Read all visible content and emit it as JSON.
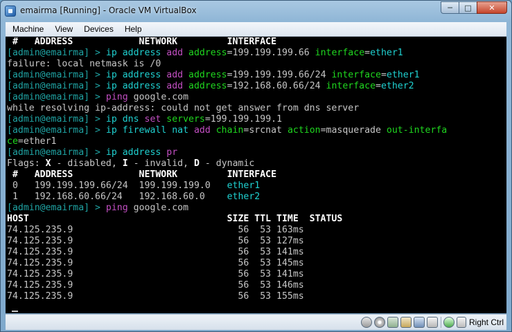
{
  "window": {
    "title": "emairma [Running] - Oracle VM VirtualBox",
    "controls": {
      "minimize": "─",
      "maximize": "□",
      "close": "✕"
    }
  },
  "menu": {
    "items": [
      "Machine",
      "View",
      "Devices",
      "Help"
    ]
  },
  "console": {
    "lines": [
      [
        {
          "t": " #   ADDRESS            NETWORK         INTERFACE",
          "c": "bold"
        }
      ],
      [
        {
          "t": "[admin@emairma] > ",
          "c": "prompt"
        },
        {
          "t": "ip address",
          "c": "path"
        },
        {
          "t": " add",
          "c": "verb"
        },
        {
          "t": " address",
          "c": "key"
        },
        {
          "t": "=199.199.199.66 ",
          "c": "val"
        },
        {
          "t": "interface",
          "c": "key"
        },
        {
          "t": "=",
          "c": "val"
        },
        {
          "t": "ether1",
          "c": "iface"
        }
      ],
      [
        {
          "t": "failure: local netmask is /0",
          "c": "val"
        }
      ],
      [
        {
          "t": "[admin@emairma] > ",
          "c": "prompt"
        },
        {
          "t": "ip address",
          "c": "path"
        },
        {
          "t": " add",
          "c": "verb"
        },
        {
          "t": " address",
          "c": "key"
        },
        {
          "t": "=199.199.199.66/24 ",
          "c": "val"
        },
        {
          "t": "interface",
          "c": "key"
        },
        {
          "t": "=",
          "c": "val"
        },
        {
          "t": "ether1",
          "c": "iface"
        }
      ],
      [
        {
          "t": "[admin@emairma] > ",
          "c": "prompt"
        },
        {
          "t": "ip address",
          "c": "path"
        },
        {
          "t": " add",
          "c": "verb"
        },
        {
          "t": " address",
          "c": "key"
        },
        {
          "t": "=192.168.60.66/24 ",
          "c": "val"
        },
        {
          "t": "interface",
          "c": "key"
        },
        {
          "t": "=",
          "c": "val"
        },
        {
          "t": "ether2",
          "c": "iface"
        }
      ],
      [
        {
          "t": "[admin@emairma] > ",
          "c": "prompt"
        },
        {
          "t": "ping",
          "c": "verb"
        },
        {
          "t": " google.com",
          "c": "val"
        }
      ],
      [
        {
          "t": "while resolving ip-address: could not get answer from dns server",
          "c": "val"
        }
      ],
      [
        {
          "t": "[admin@emairma] > ",
          "c": "prompt"
        },
        {
          "t": "ip dns",
          "c": "path"
        },
        {
          "t": " set",
          "c": "verb"
        },
        {
          "t": " servers",
          "c": "key"
        },
        {
          "t": "=199.199.199.1",
          "c": "val"
        }
      ],
      [
        {
          "t": "[admin@emairma] > ",
          "c": "prompt"
        },
        {
          "t": "ip firewall nat",
          "c": "path"
        },
        {
          "t": " add",
          "c": "verb"
        },
        {
          "t": " chain",
          "c": "key"
        },
        {
          "t": "=srcnat ",
          "c": "val"
        },
        {
          "t": "action",
          "c": "key"
        },
        {
          "t": "=masquerade ",
          "c": "val"
        },
        {
          "t": "out-interfa",
          "c": "key"
        }
      ],
      [
        {
          "t": "ce",
          "c": "key"
        },
        {
          "t": "=ether1",
          "c": "val"
        }
      ],
      [
        {
          "t": "[admin@emairma] > ",
          "c": "prompt"
        },
        {
          "t": "ip address",
          "c": "path"
        },
        {
          "t": " pr",
          "c": "verb"
        }
      ],
      [
        {
          "t": "Flags: ",
          "c": "val"
        },
        {
          "t": "X",
          "c": "bold"
        },
        {
          "t": " - disabled, ",
          "c": "val"
        },
        {
          "t": "I",
          "c": "bold"
        },
        {
          "t": " - invalid, ",
          "c": "val"
        },
        {
          "t": "D",
          "c": "bold"
        },
        {
          "t": " - dynamic",
          "c": "val"
        }
      ],
      [
        {
          "t": " #   ADDRESS            NETWORK         INTERFACE",
          "c": "bold"
        }
      ],
      [
        {
          "t": " 0   199.199.199.66/24  199.199.199.0   ",
          "c": "val"
        },
        {
          "t": "ether1",
          "c": "iface"
        }
      ],
      [
        {
          "t": " 1   192.168.60.66/24   192.168.60.0    ",
          "c": "val"
        },
        {
          "t": "ether2",
          "c": "iface"
        }
      ],
      [
        {
          "t": "[admin@emairma] > ",
          "c": "prompt"
        },
        {
          "t": "ping",
          "c": "verb"
        },
        {
          "t": " google.com",
          "c": "val"
        }
      ],
      [
        {
          "t": "HOST                                    SIZE TTL TIME  STATUS",
          "c": "bold"
        }
      ],
      [
        {
          "t": "74.125.235.9                              56  53 163ms",
          "c": "val"
        }
      ],
      [
        {
          "t": "74.125.235.9                              56  53 127ms",
          "c": "val"
        }
      ],
      [
        {
          "t": "74.125.235.9                              56  53 141ms",
          "c": "val"
        }
      ],
      [
        {
          "t": "74.125.235.9                              56  53 145ms",
          "c": "val"
        }
      ],
      [
        {
          "t": "74.125.235.9                              56  53 141ms",
          "c": "val"
        }
      ],
      [
        {
          "t": "74.125.235.9                              56  53 146ms",
          "c": "val"
        }
      ],
      [
        {
          "t": "74.125.235.9                              56  53 155ms",
          "c": "val"
        }
      ]
    ]
  },
  "statusbar": {
    "icons": [
      "hdd-icon",
      "cd-icon",
      "usb-icon",
      "shared-folders-icon",
      "network-icon",
      "display-icon",
      "mouse-integration-icon",
      "host-key-icon"
    ],
    "host_key_label": "Right Ctrl"
  },
  "colors": {
    "prompt": "#1fa3a3",
    "path": "#1fd0d0",
    "verb": "#c34fc3",
    "key": "#1fd71f",
    "text": "#c6c6c6",
    "console_bg": "#000000"
  }
}
